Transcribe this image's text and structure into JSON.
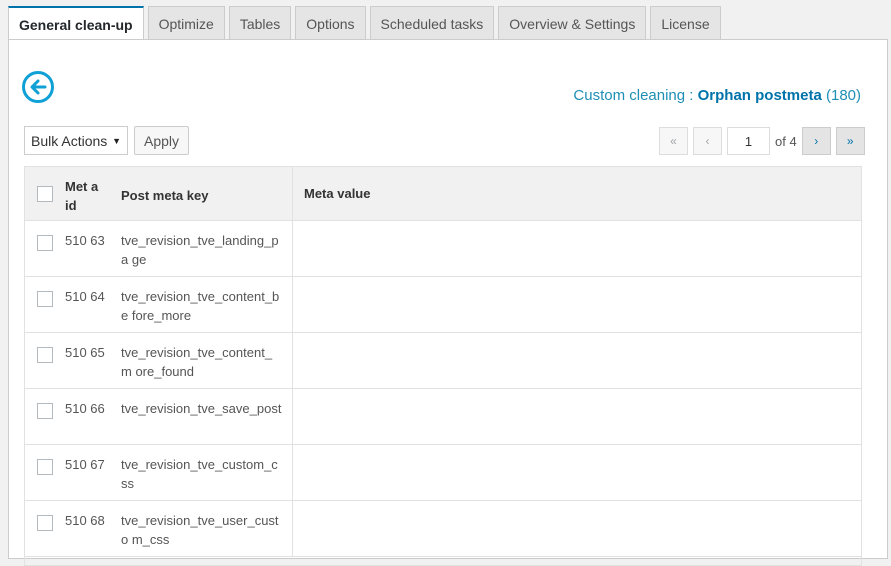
{
  "tabs": [
    {
      "label": "General clean-up",
      "active": true
    },
    {
      "label": "Optimize"
    },
    {
      "label": "Tables"
    },
    {
      "label": "Options"
    },
    {
      "label": "Scheduled tasks"
    },
    {
      "label": "Overview & Settings"
    },
    {
      "label": "License"
    }
  ],
  "header": {
    "prefix": "Custom cleaning : ",
    "strong": "Orphan postmeta",
    "count": " (180)"
  },
  "icons": {
    "back": "back-arrow-circle-icon",
    "accent": "#0fa0d6"
  },
  "toolbar": {
    "bulk_label": "Bulk Actions",
    "bulk_caret": "▼",
    "apply_label": "Apply"
  },
  "pagination": {
    "first": "«",
    "prev": "‹",
    "current": "1",
    "of_label": "of 4",
    "next": "›",
    "last": "»"
  },
  "table": {
    "columns": [
      "Met a id",
      "Post meta key",
      "Meta value"
    ],
    "rows": [
      {
        "id": "510 63",
        "key": "tve_revision_tve_landing_pa ge",
        "value": ""
      },
      {
        "id": "510 64",
        "key": "tve_revision_tve_content_be fore_more",
        "value": ""
      },
      {
        "id": "510 65",
        "key": "tve_revision_tve_content_m ore_found",
        "value": ""
      },
      {
        "id": "510 66",
        "key": "tve_revision_tve_save_post",
        "value": ""
      },
      {
        "id": "510 67",
        "key": "tve_revision_tve_custom_css",
        "value": ""
      },
      {
        "id": "510 68",
        "key": "tve_revision_tve_user_custo m_css",
        "value": ""
      }
    ]
  }
}
